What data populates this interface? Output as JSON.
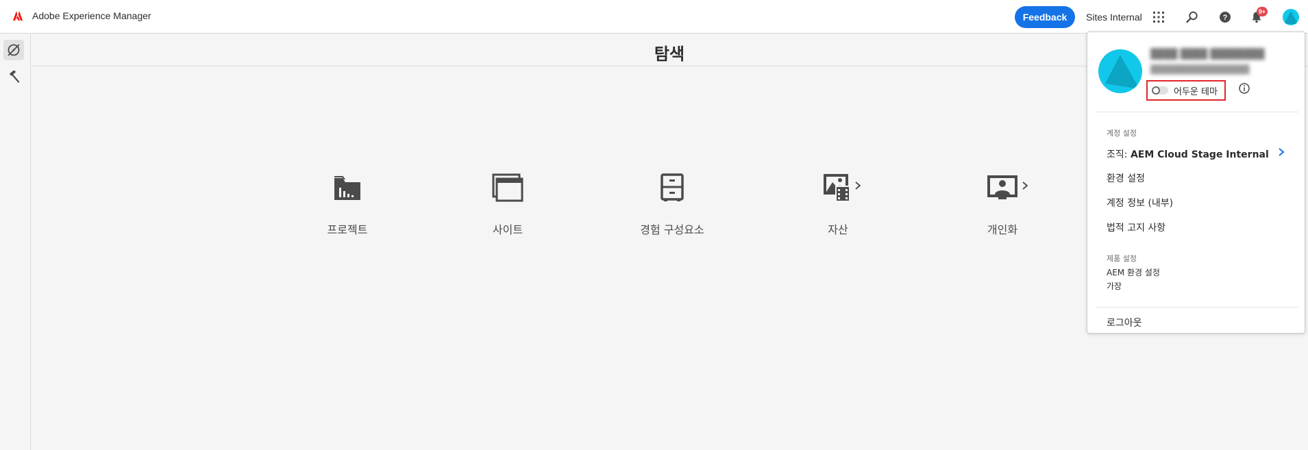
{
  "app": {
    "name": "Adobe Experience Manager"
  },
  "topbar": {
    "feedback_label": "Feedback",
    "org_label": "Sites Internal",
    "notification_count": "9+",
    "accent": "#1473e6"
  },
  "page": {
    "title": "탐색"
  },
  "tiles": [
    {
      "label": "프로젝트",
      "icon": "projects-folder-icon"
    },
    {
      "label": "사이트",
      "icon": "sites-icon"
    },
    {
      "label": "경험 구성요소",
      "icon": "experience-fragments-icon"
    },
    {
      "label": "자산",
      "icon": "assets-icon"
    },
    {
      "label": "개인화",
      "icon": "personalization-icon"
    }
  ],
  "account": {
    "theme_label": "어두운 테마",
    "account_settings_header": "계정 설정",
    "org_prefix": "조직:",
    "org_value": "AEM Cloud Stage Internal",
    "preferences": "환경 설정",
    "account_info": "계정 정보 (내부)",
    "legal_notices": "법적 고지 사항",
    "product_settings_header": "제품 설정",
    "aem_preferences": "AEM 환경 설정",
    "impersonate": "가장",
    "logout": "로그아웃"
  }
}
